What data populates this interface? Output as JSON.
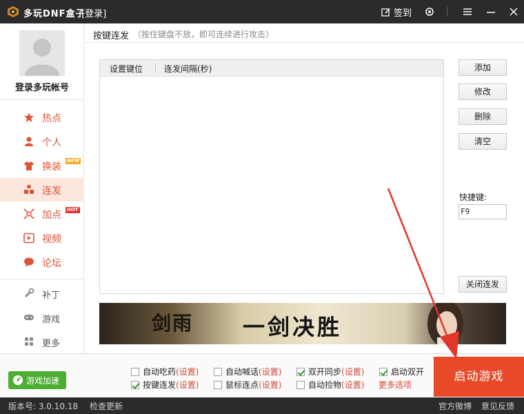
{
  "titlebar": {
    "app_title": "多玩DNF盒子",
    "login_link": "[登录]",
    "signin_label": "签到"
  },
  "sidebar": {
    "account_label": "登录多玩帐号",
    "items": [
      {
        "label": "热点",
        "icon": "star-icon"
      },
      {
        "label": "个人",
        "icon": "person-icon"
      },
      {
        "label": "换装",
        "icon": "shirt-icon",
        "badge": "NEW"
      },
      {
        "label": "连发",
        "icon": "blocks-icon",
        "active": true
      },
      {
        "label": "加点",
        "icon": "crosshair-icon",
        "badge": "HOT"
      },
      {
        "label": "视频",
        "icon": "play-icon"
      },
      {
        "label": "论坛",
        "icon": "chat-icon"
      }
    ],
    "tools": [
      {
        "label": "补丁",
        "icon": "wrench-icon"
      },
      {
        "label": "游戏",
        "icon": "gamepad-icon"
      },
      {
        "label": "更多",
        "icon": "grid-icon"
      }
    ]
  },
  "main": {
    "title": "按键连发",
    "hint": "（按住键盘不放，即可连续进行攻击）",
    "table": {
      "columns": [
        "设置键位",
        "连发间隔(秒)"
      ],
      "rows": []
    },
    "buttons": {
      "add": "添加",
      "modify": "修改",
      "delete": "删除",
      "clear": "清空",
      "close_rapid": "关闭连发"
    },
    "hotkey_label": "快捷键:",
    "hotkey_value": "F9",
    "banner": {
      "logo": "剑雨",
      "slogan": "一剑决胜"
    }
  },
  "bottom": {
    "speed_button": "游戏加速",
    "options": [
      {
        "label": "自动吃药",
        "set": "(设置)",
        "checked": false
      },
      {
        "label": "自动喊话",
        "set": "(设置)",
        "checked": false
      },
      {
        "label": "双开同步",
        "set": "(设置)",
        "checked": true
      },
      {
        "label": "启动双开",
        "set": "",
        "checked": true
      },
      {
        "label": "按键连发",
        "set": "(设置)",
        "checked": true
      },
      {
        "label": "鼠标连点",
        "set": "(设置)",
        "checked": false
      },
      {
        "label": "自动捡物",
        "set": "(设置)",
        "checked": false
      }
    ],
    "more_options": "更多选项",
    "launch_button": "启动游戏"
  },
  "status": {
    "version": "版本号: 3.0.10.18",
    "check_update": "检查更新",
    "weibo": "官方微博",
    "feedback": "意见反馈"
  },
  "colors": {
    "accent": "#e84a29",
    "nav_text": "#e0533a",
    "active_bg": "#fbe7dd",
    "speed_green": "#4cae33",
    "titlebar": "#2b2b2b"
  }
}
